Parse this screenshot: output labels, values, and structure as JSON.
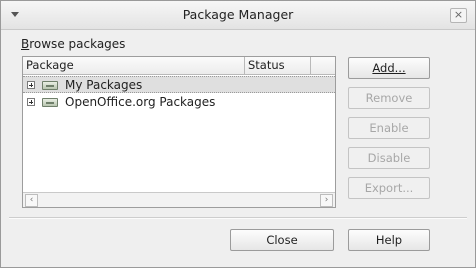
{
  "window": {
    "title": "Package Manager",
    "close_glyph": "×"
  },
  "browse": {
    "label_accel": "B",
    "label_rest": "rowse packages"
  },
  "table": {
    "columns": [
      "Package",
      "Status"
    ],
    "rows": [
      {
        "name": "My Packages",
        "icon": "package-folder-icon",
        "selected": true
      },
      {
        "name": "OpenOffice.org Packages",
        "icon": "package-folder-icon",
        "selected": false
      }
    ],
    "scroll_left": "‹",
    "scroll_right": "›"
  },
  "actions": {
    "add": "Add...",
    "remove": "Remove",
    "enable": "Enable",
    "disable": "Disable",
    "export": "Export..."
  },
  "footer": {
    "close": "Close",
    "help": "Help"
  },
  "colors": {
    "window_bg": "#efefef",
    "selection": "#dfdfdf",
    "disabled_text": "#a7a7a7"
  }
}
